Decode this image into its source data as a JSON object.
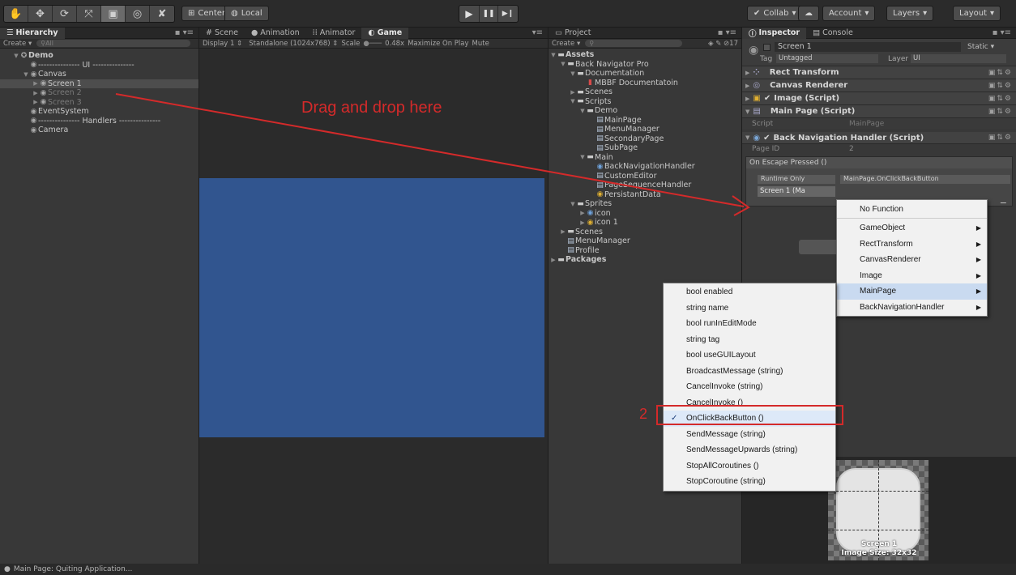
{
  "toolbar": {
    "tools": [
      {
        "name": "hand-icon",
        "glyph": "✋"
      },
      {
        "name": "move-icon",
        "glyph": "✥"
      },
      {
        "name": "rotate-icon",
        "glyph": "⟳"
      },
      {
        "name": "scale-icon",
        "glyph": "⤧"
      },
      {
        "name": "rect-tool-icon",
        "glyph": "▣"
      },
      {
        "name": "transform-icon",
        "glyph": "◎"
      },
      {
        "name": "custom-tool-icon",
        "glyph": "✘"
      }
    ],
    "pivot": "Center",
    "space": "Local",
    "play": "▶",
    "pause": "❚❚",
    "step": "▶❙",
    "collab": "Collab",
    "account": "Account",
    "layers": "Layers",
    "layout": "Layout"
  },
  "hierarchy": {
    "tab": "Hierarchy",
    "create": "Create",
    "search": "All",
    "items": [
      {
        "label": "Demo",
        "depth": 0,
        "arrow": "▼",
        "icon": "✪",
        "bold": true
      },
      {
        "label": "--------------- UI ---------------",
        "depth": 1,
        "arrow": "",
        "icon": "◉"
      },
      {
        "label": "Canvas",
        "depth": 1,
        "arrow": "▼",
        "icon": "◉"
      },
      {
        "label": "Screen 1",
        "depth": 2,
        "arrow": "▶",
        "icon": "◉",
        "sel": true
      },
      {
        "label": "Screen 2",
        "depth": 2,
        "arrow": "▶",
        "icon": "◉",
        "dim": true
      },
      {
        "label": "Screen 3",
        "depth": 2,
        "arrow": "▶",
        "icon": "◉",
        "dim": true
      },
      {
        "label": "EventSystem",
        "depth": 1,
        "arrow": "",
        "icon": "◉"
      },
      {
        "label": "--------------- Handlers ---------------",
        "depth": 1,
        "arrow": "",
        "icon": "◉"
      },
      {
        "label": "Camera",
        "depth": 1,
        "arrow": "",
        "icon": "◉"
      }
    ]
  },
  "viewtabs": {
    "scene": "Scene",
    "animation": "Animation",
    "animator": "Animator",
    "game": "Game"
  },
  "gamebar": {
    "display": "Display 1",
    "aspect": "Standalone (1024x768)",
    "scale_label": "Scale",
    "scale_value": "0.48x",
    "maximize": "Maximize On Play",
    "mute": "Mute"
  },
  "project": {
    "tab": "Project",
    "create": "Create",
    "count": "17",
    "items": [
      {
        "label": "Assets",
        "depth": 0,
        "arrow": "▼",
        "type": "folder",
        "bold": true
      },
      {
        "label": "Back Navigator Pro",
        "depth": 1,
        "arrow": "▼",
        "type": "folder"
      },
      {
        "label": "Documentation",
        "depth": 2,
        "arrow": "▼",
        "type": "folder"
      },
      {
        "label": "MBBF Documentatoin",
        "depth": 3,
        "arrow": "",
        "type": "pdf"
      },
      {
        "label": "Scenes",
        "depth": 2,
        "arrow": "▶",
        "type": "folder"
      },
      {
        "label": "Scripts",
        "depth": 2,
        "arrow": "▼",
        "type": "folder"
      },
      {
        "label": "Demo",
        "depth": 3,
        "arrow": "▼",
        "type": "folder"
      },
      {
        "label": "MainPage",
        "depth": 4,
        "arrow": "",
        "type": "script"
      },
      {
        "label": "MenuManager",
        "depth": 4,
        "arrow": "",
        "type": "script"
      },
      {
        "label": "SecondaryPage",
        "depth": 4,
        "arrow": "",
        "type": "script"
      },
      {
        "label": "SubPage",
        "depth": 4,
        "arrow": "",
        "type": "script"
      },
      {
        "label": "Main",
        "depth": 3,
        "arrow": "▼",
        "type": "folder"
      },
      {
        "label": "BackNavigationHandler",
        "depth": 4,
        "arrow": "",
        "type": "cs"
      },
      {
        "label": "CustomEditor",
        "depth": 4,
        "arrow": "",
        "type": "script"
      },
      {
        "label": "PageSequenceHandler",
        "depth": 4,
        "arrow": "",
        "type": "script"
      },
      {
        "label": "PersistantData",
        "depth": 4,
        "arrow": "",
        "type": "yellow"
      },
      {
        "label": "Sprites",
        "depth": 2,
        "arrow": "▼",
        "type": "folder"
      },
      {
        "label": "icon",
        "depth": 3,
        "arrow": "▶",
        "type": "cs"
      },
      {
        "label": "icon 1",
        "depth": 3,
        "arrow": "▶",
        "type": "yellow"
      },
      {
        "label": "Scenes",
        "depth": 1,
        "arrow": "▶",
        "type": "folder"
      },
      {
        "label": "MenuManager",
        "depth": 1,
        "arrow": "",
        "type": "script"
      },
      {
        "label": "Profile",
        "depth": 1,
        "arrow": "",
        "type": "script"
      },
      {
        "label": "Packages",
        "depth": 0,
        "arrow": "▶",
        "type": "folder",
        "bold": true
      }
    ]
  },
  "inspector": {
    "tab": "Inspector",
    "console": "Console",
    "object_name": "Screen 1",
    "static": "Static",
    "tag_label": "Tag",
    "tag_value": "Untagged",
    "layer_label": "Layer",
    "layer_value": "UI",
    "components": [
      "Rect Transform",
      "Canvas Renderer",
      "Image (Script)",
      "Main Page (Script)"
    ],
    "script_label": "Script",
    "script_value": "MainPage",
    "handler_title": "Back Navigation Handler (Script)",
    "page_id_label": "Page ID",
    "page_id_value": "2",
    "event_label": "On Escape Pressed ()",
    "runtime": "Runtime Only",
    "function": "MainPage.OnClickBackButton",
    "target": "Screen 1 (Ma",
    "preview_name": "Screen 1",
    "preview_size": "Image Size: 32x32"
  },
  "menu1": {
    "items": [
      {
        "label": "No Function",
        "sub": false
      },
      {
        "label": "GameObject",
        "sub": true
      },
      {
        "label": "RectTransform",
        "sub": true
      },
      {
        "label": "CanvasRenderer",
        "sub": true
      },
      {
        "label": "Image",
        "sub": true
      },
      {
        "label": "MainPage",
        "sub": true,
        "hl": true
      },
      {
        "label": "BackNavigationHandler",
        "sub": true
      }
    ]
  },
  "menu2": {
    "items": [
      {
        "label": "bool enabled"
      },
      {
        "label": "string name"
      },
      {
        "label": "bool runInEditMode"
      },
      {
        "label": "string tag"
      },
      {
        "label": "bool useGUILayout"
      },
      {
        "label": "BroadcastMessage (string)"
      },
      {
        "label": "CancelInvoke (string)"
      },
      {
        "label": "CancelInvoke ()"
      },
      {
        "label": "OnClickBackButton ()",
        "checked": true
      },
      {
        "label": "SendMessage (string)"
      },
      {
        "label": "SendMessageUpwards (string)"
      },
      {
        "label": "StopAllCoroutines ()"
      },
      {
        "label": "StopCoroutine (string)"
      }
    ]
  },
  "annotations": {
    "drag_text": "Drag and drop here",
    "step": "2",
    "color": "#d42a2a"
  },
  "status": "Main Page: Quiting Application..."
}
